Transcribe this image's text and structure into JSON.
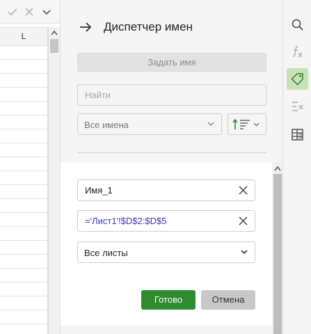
{
  "sheet": {
    "column_header": "L",
    "formula_bar_icons": [
      "check-icon",
      "cross-icon",
      "chevron-down-icon"
    ]
  },
  "panel": {
    "title": "Диспетчер имен",
    "define_name_label": "Задать имя",
    "find_placeholder": "Найти",
    "filter_selected": "Все имена",
    "sort_icon": "sort-ascending-icon"
  },
  "edit": {
    "name_value": "Имя_1",
    "reference_value": "='Лист1'!$D$2:$D$5",
    "scope_selected": "Все листы",
    "ok_label": "Готово",
    "cancel_label": "Отмена"
  },
  "toolbar": {
    "items": [
      {
        "icon": "search-icon",
        "active": false
      },
      {
        "icon": "function-icon",
        "active": false
      },
      {
        "icon": "tag-icon",
        "active": true
      },
      {
        "icon": "formula-check-icon",
        "active": false
      },
      {
        "icon": "table-icon",
        "active": false
      }
    ]
  },
  "colors": {
    "accent_green": "#2e8b2e",
    "active_tool_bg": "#c7e2b4",
    "reference_text": "#3a3ab0"
  }
}
